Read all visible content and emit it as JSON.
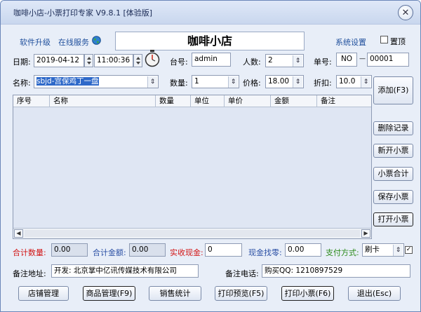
{
  "window": {
    "title": "咖啡小店-小票打印专家 V9.8.1 [体验版]"
  },
  "header": {
    "upgrade": "软件升级",
    "service": "在线服务",
    "shop_name": "咖啡小店",
    "settings": "系统设置",
    "topmost_label": "置顶"
  },
  "form": {
    "date_label": "日期:",
    "date_value": "2019-04-12",
    "time_value": "11:00:36",
    "table_label": "台号:",
    "table_value": "admin",
    "people_label": "人数:",
    "people_value": "2",
    "order_label": "单号:",
    "order_prefix": "NO",
    "order_dash": "—",
    "order_value": "00001",
    "name_label": "名称:",
    "name_value": "sbjd-宫保鸡丁一盘",
    "qty_label": "数量:",
    "qty_value": "1",
    "price_label": "价格:",
    "price_value": "18.00",
    "discount_label": "折扣:",
    "discount_value": "10.0"
  },
  "grid": {
    "columns": [
      "序号",
      "名称",
      "数量",
      "单位",
      "单价",
      "金额",
      "备注"
    ]
  },
  "side_buttons": {
    "add": "添加(F3)",
    "delete": "删除记录",
    "new": "新开小票",
    "total": "小票合计",
    "save": "保存小票",
    "open": "打开小票"
  },
  "totals": {
    "count_label": "合计数量:",
    "count_value": "0.00",
    "amount_label": "合计金额:",
    "amount_value": "0.00",
    "received_label": "实收现金:",
    "received_value": "0",
    "change_label": "现金找零:",
    "change_value": "0.00",
    "pay_label": "支付方式:",
    "pay_value": "刷卡"
  },
  "footer_info": {
    "address_label": "备注地址:",
    "address_value": "开发: 北京掌中亿讯传媒技术有限公司",
    "phone_label": "备注电话:",
    "phone_value": "购买QQ: 1210897529"
  },
  "bottom_buttons": {
    "shop_mgmt": "店铺管理",
    "product_mgmt": "商品管理(F9)",
    "sales_stats": "销售统计",
    "print_preview": "打印预览(F5)",
    "print": "打印小票(F6)",
    "exit": "退出(Esc)"
  },
  "colors": {
    "red_label": "#d21414",
    "blue_label": "#2a4fa4",
    "green_label": "#2a8a18",
    "link": "#1f4f9c"
  },
  "icons": {
    "globe": "globe-icon",
    "stopwatch": "stopwatch-icon",
    "close": "close-icon"
  }
}
